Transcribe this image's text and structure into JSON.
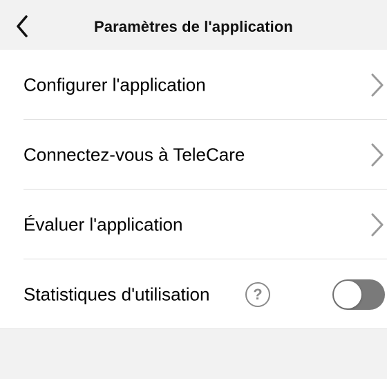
{
  "header": {
    "title": "Paramètres de l'application",
    "back_icon": "chevron-left-icon"
  },
  "settings": {
    "items": [
      {
        "label": "Configurer l'application",
        "icon": "chevron-right-icon"
      },
      {
        "label": "Connectez-vous à TeleCare",
        "icon": "chevron-right-icon"
      },
      {
        "label": "Évaluer l'application",
        "icon": "chevron-right-icon"
      }
    ],
    "usage_stats": {
      "label": "Statistiques d'utilisation",
      "help_icon": "question-circle-icon",
      "help_glyph": "?",
      "toggle_on": false
    }
  },
  "colors": {
    "background": "#f2f2f2",
    "list_background": "#ffffff",
    "chevron": "#9a9a9a",
    "toggle_off": "#7a7a7a",
    "divider": "#dcdcdc"
  }
}
